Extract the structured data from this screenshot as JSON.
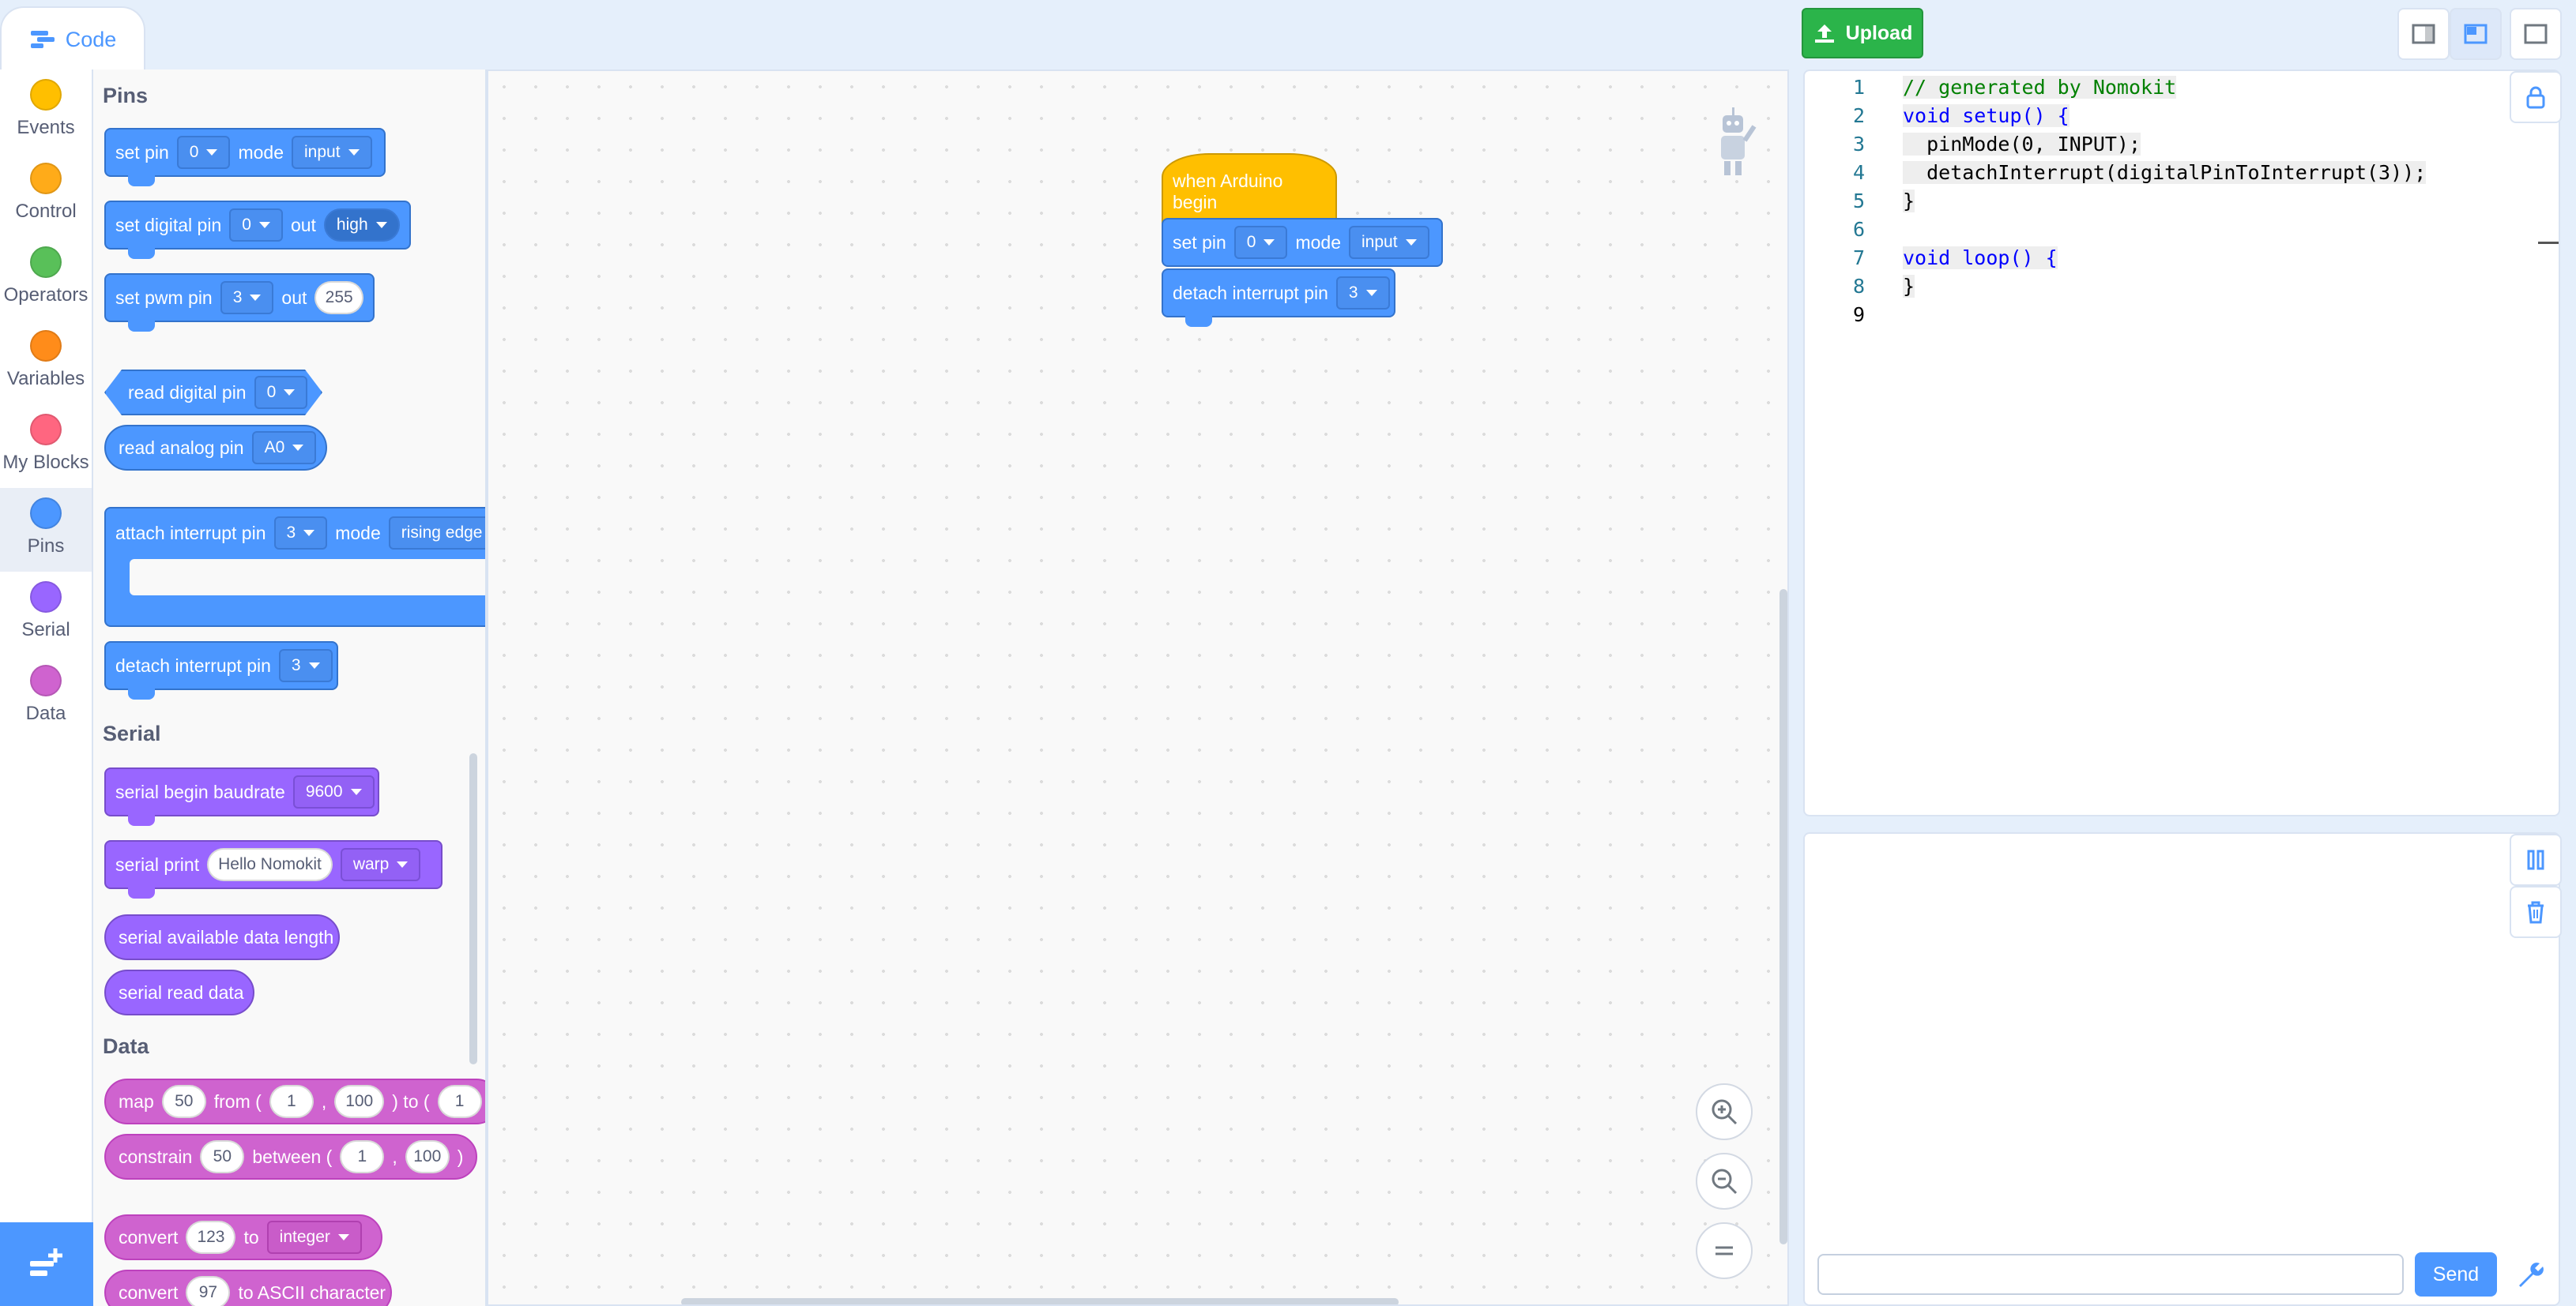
{
  "tabs": {
    "code": "Code"
  },
  "toolbar": {
    "upload_label": "Upload"
  },
  "categories": [
    {
      "label": "Events",
      "color": "#ffbf00"
    },
    {
      "label": "Control",
      "color": "#ffab19"
    },
    {
      "label": "Operators",
      "color": "#59c059"
    },
    {
      "label": "Variables",
      "color": "#ff8c1a"
    },
    {
      "label": "My Blocks",
      "color": "#ff6680"
    },
    {
      "label": "Pins",
      "color": "#4c97ff"
    },
    {
      "label": "Serial",
      "color": "#9966ff"
    },
    {
      "label": "Data",
      "color": "#cf63cf"
    }
  ],
  "palette": {
    "pins_title": "Pins",
    "serial_title": "Serial",
    "data_title": "Data",
    "set_pin": {
      "label": "set pin",
      "pin": "0",
      "mode_label": "mode",
      "mode": "input"
    },
    "set_digital_pin": {
      "label": "set digital pin",
      "pin": "0",
      "out_label": "out",
      "value": "high"
    },
    "set_pwm_pin": {
      "label": "set pwm pin",
      "pin": "3",
      "out_label": "out",
      "value": "255"
    },
    "read_digital_pin": {
      "label": "read digital pin",
      "pin": "0"
    },
    "read_analog_pin": {
      "label": "read analog pin",
      "pin": "A0"
    },
    "attach_interrupt": {
      "label": "attach interrupt pin",
      "pin": "3",
      "mode_label": "mode",
      "mode": "rising edge"
    },
    "detach_interrupt": {
      "label": "detach interrupt pin",
      "pin": "3"
    },
    "serial_begin": {
      "label": "serial begin baudrate",
      "value": "9600"
    },
    "serial_print": {
      "label": "serial print",
      "text": "Hello Nomokit",
      "mode": "warp"
    },
    "serial_available": {
      "label": "serial available data length"
    },
    "serial_read": {
      "label": "serial read data"
    },
    "map": {
      "label": "map",
      "value": "50",
      "from_label": "from (",
      "a": "1",
      "comma": ",",
      "b": "100",
      "to_label": ") to (",
      "c": "1"
    },
    "constrain": {
      "label": "constrain",
      "value": "50",
      "between_label": "between (",
      "a": "1",
      "comma": ",",
      "b": "100",
      "close": ")"
    },
    "convert": {
      "label": "convert",
      "value": "123",
      "to_label": "to",
      "type": "integer"
    },
    "convert_ascii": {
      "label": "convert",
      "value": "97",
      "to_label": "to ASCII character"
    }
  },
  "workspace": {
    "hat": "when Arduino begin",
    "set_pin": {
      "label": "set pin",
      "pin": "0",
      "mode_label": "mode",
      "mode": "input"
    },
    "detach": {
      "label": "detach interrupt pin",
      "pin": "3"
    }
  },
  "code": {
    "line_numbers": [
      "1",
      "2",
      "3",
      "4",
      "5",
      "6",
      "7",
      "8",
      "9"
    ],
    "lines": [
      "// generated by Nomokit",
      "void setup() {",
      "  pinMode(0, INPUT);",
      "  detachInterrupt(digitalPinToInterrupt(3));",
      "}",
      "",
      "void loop() {",
      "}",
      ""
    ]
  },
  "serial": {
    "input_placeholder": "",
    "send_label": "Send"
  }
}
